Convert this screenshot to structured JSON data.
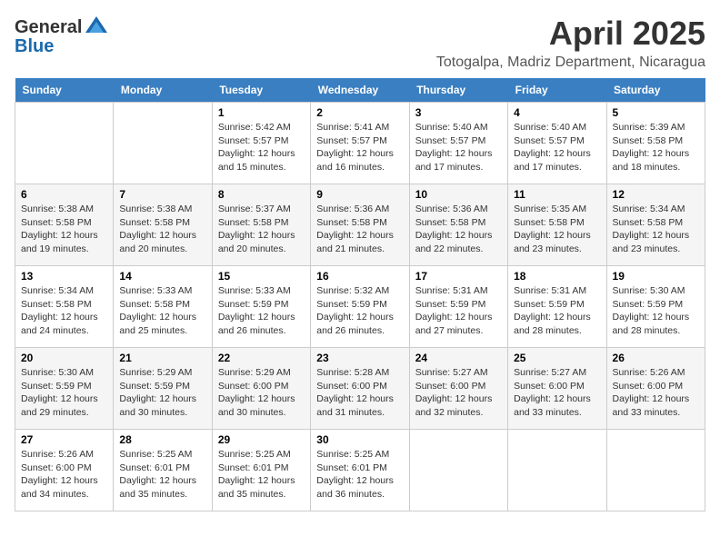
{
  "logo": {
    "general": "General",
    "blue": "Blue"
  },
  "title": {
    "month": "April 2025",
    "location": "Totogalpa, Madriz Department, Nicaragua"
  },
  "weekdays": [
    "Sunday",
    "Monday",
    "Tuesday",
    "Wednesday",
    "Thursday",
    "Friday",
    "Saturday"
  ],
  "weeks": [
    [
      {
        "day": "",
        "info": ""
      },
      {
        "day": "",
        "info": ""
      },
      {
        "day": "1",
        "info": "Sunrise: 5:42 AM\nSunset: 5:57 PM\nDaylight: 12 hours and 15 minutes."
      },
      {
        "day": "2",
        "info": "Sunrise: 5:41 AM\nSunset: 5:57 PM\nDaylight: 12 hours and 16 minutes."
      },
      {
        "day": "3",
        "info": "Sunrise: 5:40 AM\nSunset: 5:57 PM\nDaylight: 12 hours and 17 minutes."
      },
      {
        "day": "4",
        "info": "Sunrise: 5:40 AM\nSunset: 5:57 PM\nDaylight: 12 hours and 17 minutes."
      },
      {
        "day": "5",
        "info": "Sunrise: 5:39 AM\nSunset: 5:58 PM\nDaylight: 12 hours and 18 minutes."
      }
    ],
    [
      {
        "day": "6",
        "info": "Sunrise: 5:38 AM\nSunset: 5:58 PM\nDaylight: 12 hours and 19 minutes."
      },
      {
        "day": "7",
        "info": "Sunrise: 5:38 AM\nSunset: 5:58 PM\nDaylight: 12 hours and 20 minutes."
      },
      {
        "day": "8",
        "info": "Sunrise: 5:37 AM\nSunset: 5:58 PM\nDaylight: 12 hours and 20 minutes."
      },
      {
        "day": "9",
        "info": "Sunrise: 5:36 AM\nSunset: 5:58 PM\nDaylight: 12 hours and 21 minutes."
      },
      {
        "day": "10",
        "info": "Sunrise: 5:36 AM\nSunset: 5:58 PM\nDaylight: 12 hours and 22 minutes."
      },
      {
        "day": "11",
        "info": "Sunrise: 5:35 AM\nSunset: 5:58 PM\nDaylight: 12 hours and 23 minutes."
      },
      {
        "day": "12",
        "info": "Sunrise: 5:34 AM\nSunset: 5:58 PM\nDaylight: 12 hours and 23 minutes."
      }
    ],
    [
      {
        "day": "13",
        "info": "Sunrise: 5:34 AM\nSunset: 5:58 PM\nDaylight: 12 hours and 24 minutes."
      },
      {
        "day": "14",
        "info": "Sunrise: 5:33 AM\nSunset: 5:58 PM\nDaylight: 12 hours and 25 minutes."
      },
      {
        "day": "15",
        "info": "Sunrise: 5:33 AM\nSunset: 5:59 PM\nDaylight: 12 hours and 26 minutes."
      },
      {
        "day": "16",
        "info": "Sunrise: 5:32 AM\nSunset: 5:59 PM\nDaylight: 12 hours and 26 minutes."
      },
      {
        "day": "17",
        "info": "Sunrise: 5:31 AM\nSunset: 5:59 PM\nDaylight: 12 hours and 27 minutes."
      },
      {
        "day": "18",
        "info": "Sunrise: 5:31 AM\nSunset: 5:59 PM\nDaylight: 12 hours and 28 minutes."
      },
      {
        "day": "19",
        "info": "Sunrise: 5:30 AM\nSunset: 5:59 PM\nDaylight: 12 hours and 28 minutes."
      }
    ],
    [
      {
        "day": "20",
        "info": "Sunrise: 5:30 AM\nSunset: 5:59 PM\nDaylight: 12 hours and 29 minutes."
      },
      {
        "day": "21",
        "info": "Sunrise: 5:29 AM\nSunset: 5:59 PM\nDaylight: 12 hours and 30 minutes."
      },
      {
        "day": "22",
        "info": "Sunrise: 5:29 AM\nSunset: 6:00 PM\nDaylight: 12 hours and 30 minutes."
      },
      {
        "day": "23",
        "info": "Sunrise: 5:28 AM\nSunset: 6:00 PM\nDaylight: 12 hours and 31 minutes."
      },
      {
        "day": "24",
        "info": "Sunrise: 5:27 AM\nSunset: 6:00 PM\nDaylight: 12 hours and 32 minutes."
      },
      {
        "day": "25",
        "info": "Sunrise: 5:27 AM\nSunset: 6:00 PM\nDaylight: 12 hours and 33 minutes."
      },
      {
        "day": "26",
        "info": "Sunrise: 5:26 AM\nSunset: 6:00 PM\nDaylight: 12 hours and 33 minutes."
      }
    ],
    [
      {
        "day": "27",
        "info": "Sunrise: 5:26 AM\nSunset: 6:00 PM\nDaylight: 12 hours and 34 minutes."
      },
      {
        "day": "28",
        "info": "Sunrise: 5:25 AM\nSunset: 6:01 PM\nDaylight: 12 hours and 35 minutes."
      },
      {
        "day": "29",
        "info": "Sunrise: 5:25 AM\nSunset: 6:01 PM\nDaylight: 12 hours and 35 minutes."
      },
      {
        "day": "30",
        "info": "Sunrise: 5:25 AM\nSunset: 6:01 PM\nDaylight: 12 hours and 36 minutes."
      },
      {
        "day": "",
        "info": ""
      },
      {
        "day": "",
        "info": ""
      },
      {
        "day": "",
        "info": ""
      }
    ]
  ]
}
